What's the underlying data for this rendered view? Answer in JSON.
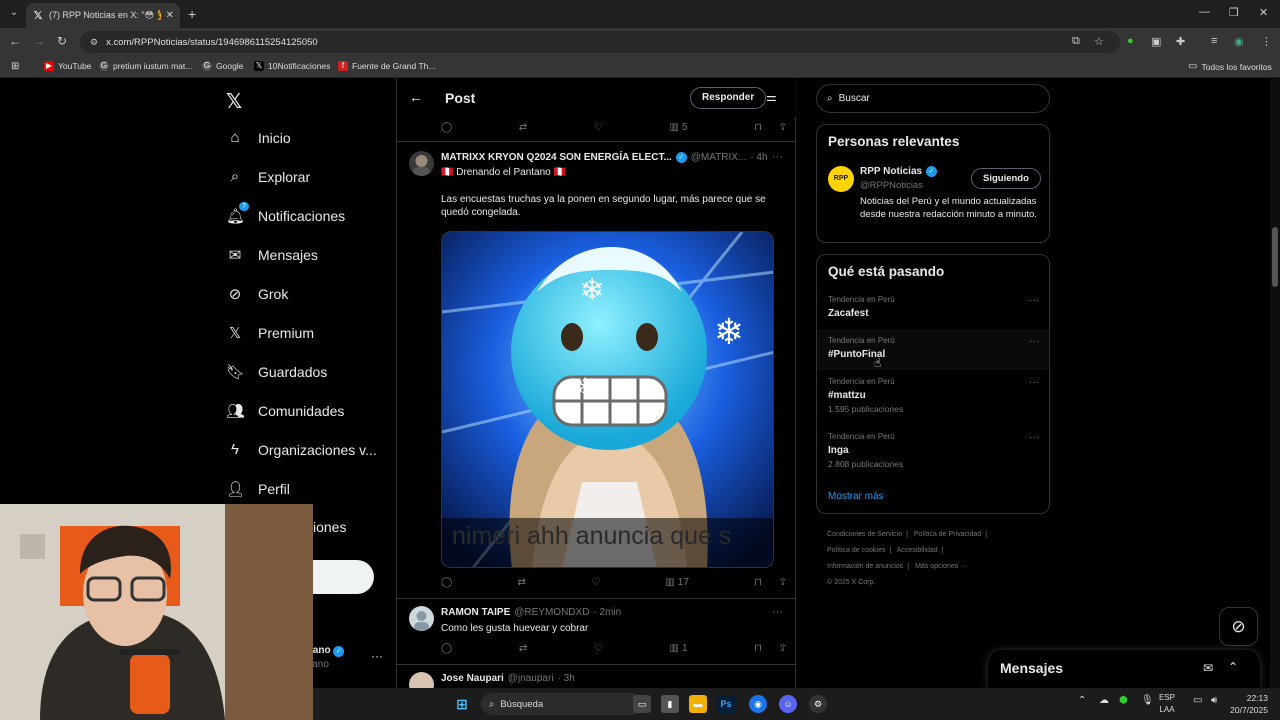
{
  "browser": {
    "tab_title": "(7) RPP Noticias en X: \"😳 💆 O",
    "tab_close": "✕",
    "new_tab": "+",
    "url": "x.com/RPPNoticias/status/1946986115254125050",
    "bookmarks": [
      "YouTube",
      "pretium iustum mat...",
      "Google",
      "10Notificaciones",
      "Fuente de Grand Th..."
    ],
    "all_bookmarks": "Todos los favoritos"
  },
  "nav": {
    "items": [
      {
        "label": "Inicio",
        "icon": "home-icon"
      },
      {
        "label": "Explorar",
        "icon": "search-icon"
      },
      {
        "label": "Notificaciones",
        "icon": "bell-icon",
        "badge": "7"
      },
      {
        "label": "Mensajes",
        "icon": "mail-icon"
      },
      {
        "label": "Grok",
        "icon": "grok-icon"
      },
      {
        "label": "Premium",
        "icon": "x-icon"
      },
      {
        "label": "Guardados",
        "icon": "bookmark-icon"
      },
      {
        "label": "Comunidades",
        "icon": "communities-icon"
      },
      {
        "label": "Organizaciones v...",
        "icon": "bolt-icon"
      },
      {
        "label": "Perfil",
        "icon": "person-icon"
      },
      {
        "label": "ciones",
        "icon": ""
      }
    ],
    "post_button": "r",
    "account_name": "iano",
    "account_handle": "lano"
  },
  "feed": {
    "title": "Post",
    "reply_button": "Responder",
    "top_actions": {
      "views": "5"
    },
    "tweets": [
      {
        "name": "MATRIXX KRYON Q2024 SON ENERGÍA ELECT...",
        "handle": "@MATRIX...",
        "time": "· 4h",
        "reply_to": "🇵🇪 Drenando el Pantano 🇵🇪",
        "text": "Las encuestas truchas ya la ponen en segundo lugar, más parece que se quedó congelada.",
        "media_caption": "nimeri ahh anuncia que s",
        "views": "17"
      },
      {
        "name": "RAMON TAIPE",
        "handle": "@REYMONDXD",
        "time": "· 2min",
        "text": "Como les gusta huevear y cobrar",
        "views": "1"
      },
      {
        "name": "Jose Naupari",
        "handle": "@jnaupari",
        "time": "· 3h"
      }
    ]
  },
  "right": {
    "search_placeholder": "Buscar",
    "relevant": {
      "title": "Personas relevantes",
      "name": "RPP Noticias",
      "handle": "@RPPNoticias",
      "bio": "Noticias del Perú y el mundo actualizadas desde nuestra redacción minuto a minuto.",
      "follow_label": "Siguiendo",
      "avatar_text": "RPP"
    },
    "trends": {
      "title": "Qué está pasando",
      "items": [
        {
          "context": "Tendencia en Perú",
          "name": "Zacafest",
          "count": ""
        },
        {
          "context": "Tendencia en Perú",
          "name": "#PuntoFinal",
          "count": ""
        },
        {
          "context": "Tendencia en Perú",
          "name": "#mattzu",
          "count": "1.595 publicaciones"
        },
        {
          "context": "Tendencia en Perú",
          "name": "Inga",
          "count": "2.808 publicaciones"
        }
      ],
      "more": "Mostrar más"
    },
    "footer": [
      "Condiciones de Servicio",
      "|",
      "Política de Privacidad",
      "|",
      "Política de cookies",
      "|",
      "Accesibilidad",
      "|",
      "Información de anuncios",
      "|",
      "Más opciones ···",
      "© 2025 X Corp."
    ]
  },
  "messages_drawer": {
    "title": "Mensajes"
  },
  "taskbar": {
    "search": "Búsqueda",
    "lang_top": "ESP",
    "lang_bottom": "LAA",
    "time": "22:13",
    "date": "20/7/2025"
  },
  "colors": {
    "accent": "#1d9bf0",
    "bg": "#000000",
    "border": "#2f3336",
    "muted": "#71767b"
  }
}
